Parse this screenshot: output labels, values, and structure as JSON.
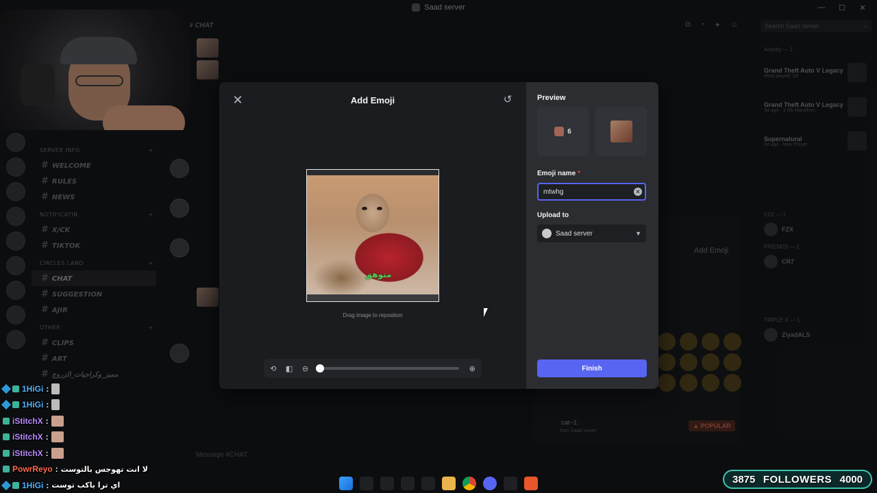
{
  "window": {
    "title": "Saad server"
  },
  "window_controls": [
    "—",
    "☐",
    "✕"
  ],
  "channels": {
    "categories": [
      {
        "name": "SERVER INFO",
        "items": [
          "WELCOME",
          "RULES",
          "NEWS"
        ]
      },
      {
        "name": "NOTIFICATIN",
        "items": [
          "X/CK",
          "TIKTOK"
        ]
      },
      {
        "name": "CIRCLES LAND",
        "items": [
          "CHAT",
          "SUGGESTION",
          "AJIR"
        ]
      },
      {
        "name": "OTHER",
        "items": [
          "CLIPS",
          "ART",
          "مميز_وكراجيات_الزروج"
        ]
      }
    ]
  },
  "chat": {
    "header": "CHAT",
    "composer_placeholder": "Message #CHAT"
  },
  "members": {
    "search_placeholder": "Search Saad server",
    "activity_header": "Activity — 1",
    "activities": [
      {
        "name": "Grand Theft Auto V Legacy",
        "sub": "Most played: 2d"
      },
      {
        "name": "Grand Theft Auto V Legacy",
        "sub": "3d ago · 3 5th Marathon"
      },
      {
        "name": "Supernatural",
        "sub": "3d ago · New Player"
      }
    ],
    "groups": [
      {
        "header": "FZX — 1",
        "name": "FZX"
      },
      {
        "header": "FRIENDS — 1",
        "name": "CR7"
      },
      {
        "header": "TRIPLE X — 1",
        "name": "ZiyadALS"
      }
    ]
  },
  "emoji_picker_bg": {
    "header": "Add Emoji",
    "emoji_name": ":cat~1:",
    "emoji_source": "from Saad server",
    "popular_label": "POPULAR"
  },
  "dialog": {
    "title": "Add Emoji",
    "close_icon": "close-icon",
    "reset_icon": "rotate-ccw-icon",
    "crop_caption": "منوهق",
    "hint": "Drag image to reposition",
    "toolbar": {
      "zoom_level": 0
    },
    "preview_label": "Preview",
    "preview_count": "6",
    "emoji_name_label": "Emoji name",
    "required_mark": "*",
    "emoji_name_value": "mtwhg",
    "upload_label": "Upload to",
    "upload_value": "Saad server",
    "finish_label": "Finish"
  },
  "stream_chat": [
    {
      "user": "1HiGi",
      "color": "#4fb4ff",
      "msg": ""
    },
    {
      "user": "1HiGi",
      "color": "#4fb4ff",
      "msg": ""
    },
    {
      "user": "iStitchX",
      "color": "#b98cff",
      "msg": ""
    },
    {
      "user": "iStitchX",
      "color": "#b98cff",
      "msg": ""
    },
    {
      "user": "iStitchX",
      "color": "#b98cff",
      "msg": ""
    },
    {
      "user": "PowrReyo",
      "color": "#ff6a4d",
      "msg": "لا انت تهوجس بالتوست"
    },
    {
      "user": "1HiGi",
      "color": "#4fb4ff",
      "msg": "اي ترا باكب توست"
    }
  ],
  "followers": {
    "current": "3875",
    "label": "FOLLOWERS",
    "goal": "4000"
  },
  "colors": {
    "accent": "#5865f2",
    "danger": "#f23f43",
    "dialog_bg": "#1f2023"
  }
}
